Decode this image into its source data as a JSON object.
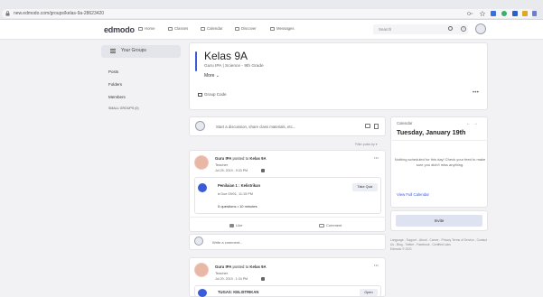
{
  "browser": {
    "url": "new.edmodo.com/groups/kelas-9a-28623420"
  },
  "nav": {
    "logo": "edmodo",
    "items": [
      "Home",
      "Classes",
      "Calendar",
      "Discover",
      "Messages"
    ],
    "search_placeholder": "Search"
  },
  "sidebar": {
    "your_groups": "Your Groups",
    "items": [
      "Posts",
      "Folders",
      "Members"
    ],
    "small_groups": "SMALL GROUPS (0)"
  },
  "group": {
    "name": "Kelas 9A",
    "subtitle": "Guru IPA | Science - 9th Grade",
    "more": "More",
    "group_code": "Group Code",
    "accent": "#3b5bd9"
  },
  "composer": {
    "placeholder": "Start a discussion, share class materials, etc...",
    "filter": "Filter posts by"
  },
  "posts": [
    {
      "author": "Guru IPA",
      "posted_to_prefix": "posted to",
      "group": "Kelas 9A",
      "role": "Teacher",
      "time": "Jul 25, 2019 - 9:33 PM",
      "attachment_title": "Penilaian 1 : Kelistrikan",
      "attachment_due": "Due 09/01, 11:15 PM",
      "attachment_meta": "5 questions • 10 minutes",
      "action": "Take Quiz",
      "like": "Like",
      "comment": "Comment"
    },
    {
      "author": "Guru IPA",
      "posted_to_prefix": "posted to",
      "group": "Kelas 9A",
      "role": "Teacher",
      "time": "Jul 20, 2019 - 1:34 PM",
      "attachment_title": "TUGAS: KELISTRIKAN",
      "action": "Open"
    }
  ],
  "comment_placeholder": "Write a comment...",
  "calendar": {
    "label": "Calendar",
    "date": "Tuesday, January 19th",
    "empty": "Nothing scheduled for this day! Check your feed to make sure you didn't miss anything.",
    "view_full": "View Full Calendar"
  },
  "invite": "Invite",
  "footer": "Language - Support - About - Career - Privacy Terms of Service - Contact Us - Blog - Twitter - Facebook - Certified Labs\nEdmodo © 2021"
}
